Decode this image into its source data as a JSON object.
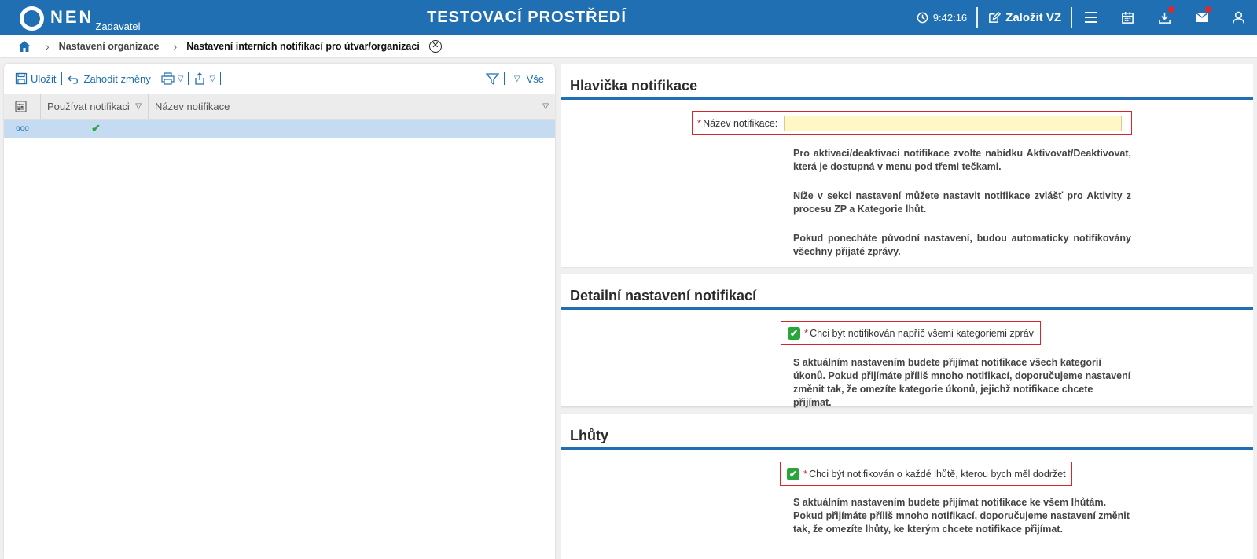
{
  "topbar": {
    "logo_text": "NEN",
    "logo_sub": "Zadavatel",
    "environment": "TESTOVACÍ PROSTŘEDÍ",
    "time": "9:42:16",
    "create_label": "Založit VZ"
  },
  "breadcrumb": {
    "item1": "Nastavení organizace",
    "current": "Nastavení interních notifikací pro útvar/organizaci"
  },
  "toolbar": {
    "save": "Uložit",
    "discard": "Zahodit změny",
    "filter_all": "Vše"
  },
  "grid": {
    "columns": [
      "Používat notifikaci",
      "Název notifikace"
    ],
    "rows": [
      {
        "menu": "ooo",
        "active": "✔",
        "name": ""
      }
    ]
  },
  "sections": {
    "header": {
      "title": "Hlavička notifikace",
      "name_label": "Název notifikace:",
      "name_value": "",
      "p1": "Pro aktivaci/deaktivaci notifikace zvolte nabídku Aktivovat/Deaktivovat, která je dostupná v menu pod třemi tečkami.",
      "p2": "Níže v sekci nastavení můžete nastavit notifikace zvlášť pro Aktivity z procesu ZP a Kategorie lhůt.",
      "p3": "Pokud ponecháte původní nastavení, budou automaticky notifikovány všechny přijaté zprávy."
    },
    "detail": {
      "title": "Detailní nastavení notifikací",
      "checkbox_label": "Chci být notifikován napříč všemi kategoriemi zpráv",
      "text": "S aktuálním nastavením budete přijímat notifikace všech kategorií úkonů. Pokud přijímáte příliš mnoho notifikací, doporučujeme nastavení změnit tak, že omezíte kategorie úkonů, jejichž notifikace chcete přijímat."
    },
    "deadlines": {
      "title": "Lhůty",
      "checkbox_label": "Chci být notifikován o každé lhůtě, kterou bych měl dodržet",
      "text": "S aktuálním nastavením budete přijímat notifikace ke všem lhůtám. Pokud přijímáte příliš mnoho notifikací, doporučujeme nastavení změnit tak, že omezíte lhůty, ke kterým chcete notifikace přijímat."
    }
  },
  "colors": {
    "brand": "#1f6fb2",
    "required": "#d9232e",
    "check": "#2aa53c",
    "selected_row": "#c5dbf2",
    "input_required": "#fff8c6"
  }
}
